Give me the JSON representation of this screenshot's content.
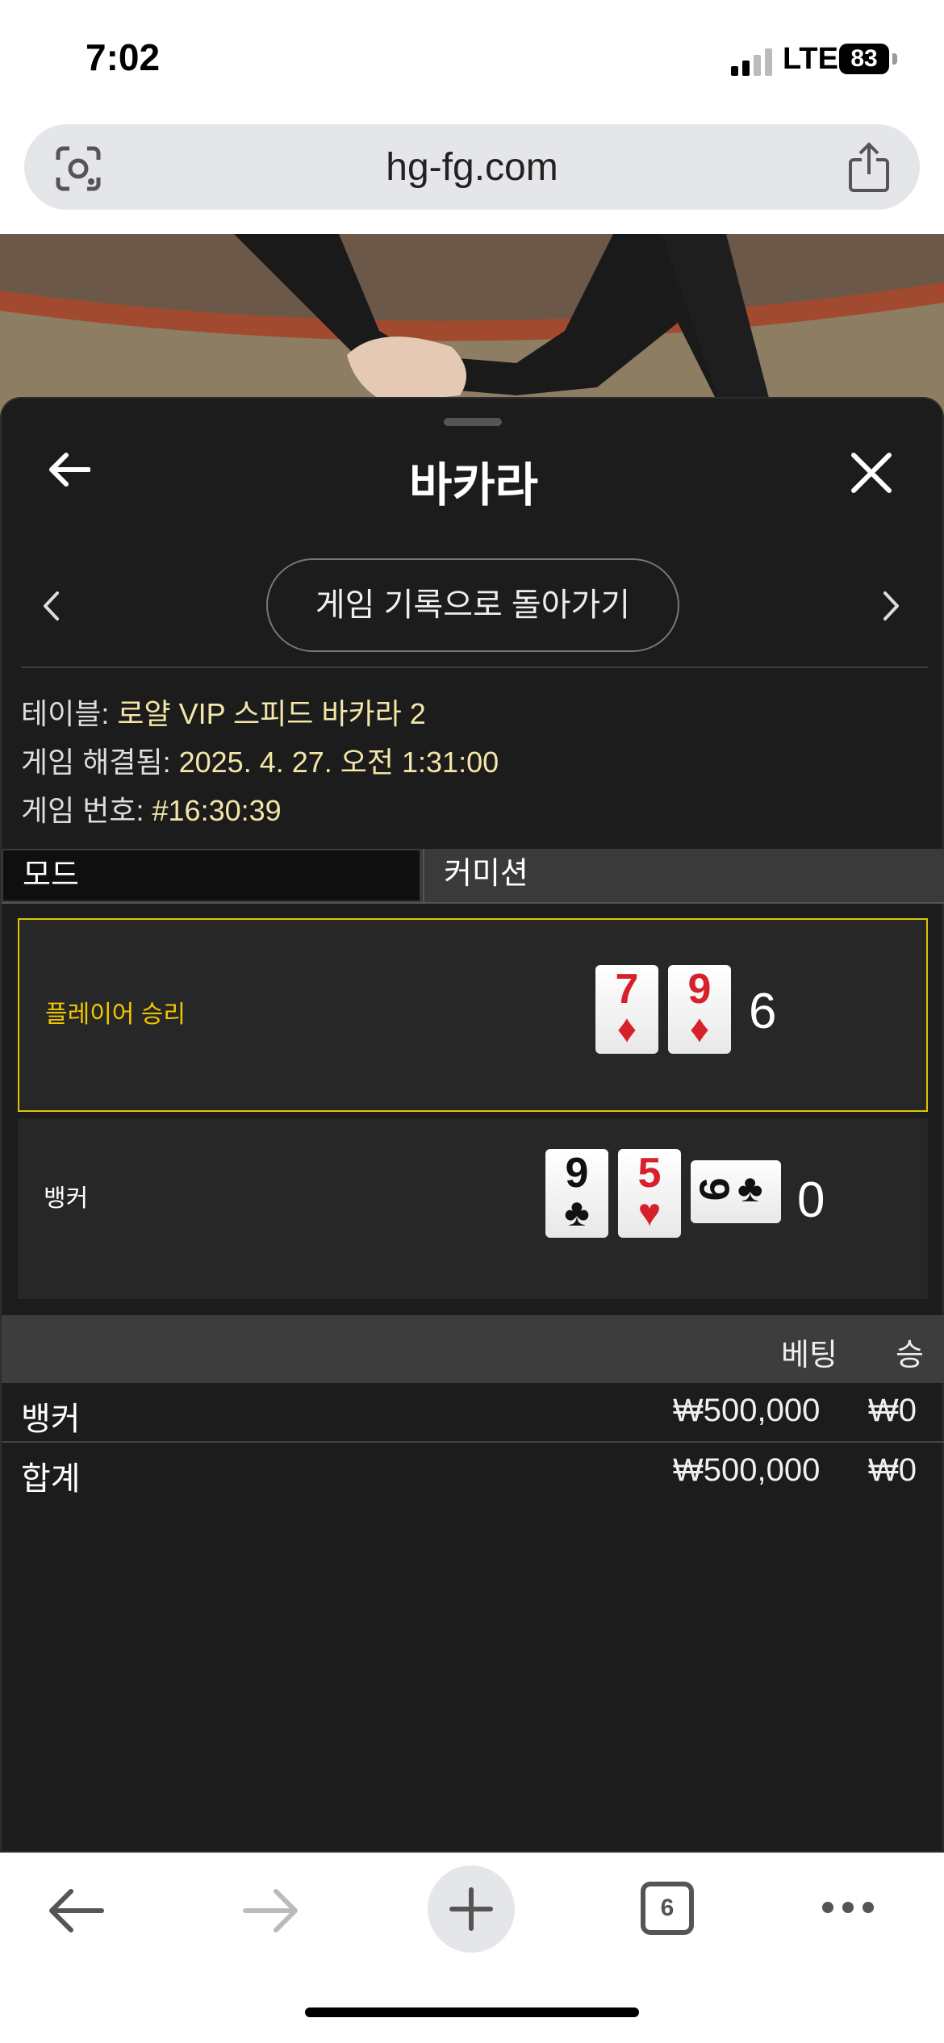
{
  "status_bar": {
    "time": "7:02",
    "network": "LTE",
    "battery": "83"
  },
  "browser": {
    "url": "hg-fg.com",
    "open_tabs": "6"
  },
  "panel": {
    "title": "바카라",
    "back_to_history": "게임 기록으로 돌아가기",
    "table_label": "테이블: ",
    "table_value": "로얄 VIP 스피드 바카라 2",
    "resolved_label": "게임 해결됨: ",
    "resolved_value": "2025. 4. 27. 오전 1:31:00",
    "game_no_label": "게임 번호: ",
    "game_no_value": "#16:30:39",
    "mode_label": "모드",
    "commission_label": "커미션"
  },
  "result": {
    "player": {
      "label": "플레이어 승리",
      "label_color": "#f0c800",
      "cards": [
        {
          "rank": "7",
          "suit": "♦",
          "color": "red"
        },
        {
          "rank": "9",
          "suit": "♦",
          "color": "red"
        }
      ],
      "score": "6"
    },
    "banker": {
      "label": "뱅커",
      "cards": [
        {
          "rank": "9",
          "suit": "♣",
          "color": "black"
        },
        {
          "rank": "5",
          "suit": "♥",
          "color": "red"
        },
        {
          "rank": "9",
          "suit": "♣",
          "color": "black",
          "orientation": "sideways"
        }
      ],
      "score": "0"
    }
  },
  "bets": {
    "headers": {
      "bet": "베팅",
      "win": "승"
    },
    "rows": [
      {
        "name": "뱅커",
        "bet": "₩500,000",
        "win": "₩0"
      }
    ],
    "total": {
      "name": "합계",
      "bet": "₩500,000",
      "win": "₩0"
    }
  },
  "colors": {
    "accent": "#f0c800",
    "panel_bg": "#1c1c1c",
    "card_red": "#d6202a"
  }
}
